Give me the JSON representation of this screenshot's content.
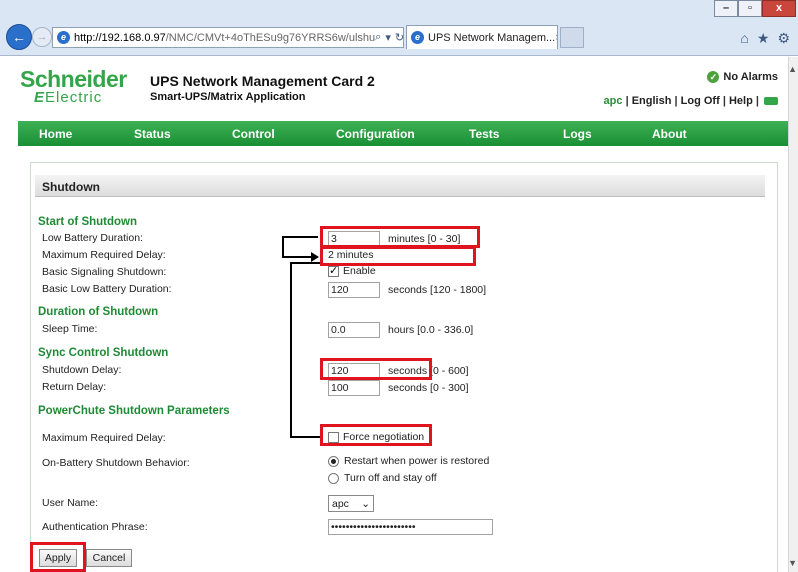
{
  "browser": {
    "url_host": "http://192.168.0.97",
    "url_path": "/NMC/CMVt+4oThESu9g76YRRS6w/ulshu",
    "tab_title": "UPS Network Managem...",
    "minimize": "–",
    "maximize": "▫",
    "close": "x"
  },
  "header": {
    "logo_line1": "Schneider",
    "logo_line2": "Electric",
    "product": "UPS Network Management Card 2",
    "subproduct": "Smart-UPS/Matrix Application",
    "alarms": "No Alarms",
    "user": "apc",
    "english": "English",
    "logoff": "Log Off",
    "help": "Help"
  },
  "nav": {
    "items": [
      "Home",
      "Status",
      "Control",
      "Configuration",
      "Tests",
      "Logs",
      "About"
    ]
  },
  "section": {
    "title": "Shutdown"
  },
  "start": {
    "heading": "Start of Shutdown",
    "low_battery_label": "Low Battery Duration:",
    "low_battery_value": "3",
    "low_battery_unit": "minutes  [0 - 30]",
    "max_delay_label": "Maximum Required Delay:",
    "max_delay_value": "2 minutes",
    "basic_signal_label": "Basic Signaling Shutdown:",
    "basic_signal_option": "Enable",
    "basic_low_label": "Basic Low Battery Duration:",
    "basic_low_value": "120",
    "basic_low_unit": "seconds  [120 - 1800]"
  },
  "duration": {
    "heading": "Duration of Shutdown",
    "sleep_label": "Sleep Time:",
    "sleep_value": "0.0",
    "sleep_unit": "hours [0.0 - 336.0]"
  },
  "sync": {
    "heading": "Sync Control Shutdown",
    "shutdown_delay_label": "Shutdown Delay:",
    "shutdown_delay_value": "120",
    "shutdown_delay_unit": "seconds  [0 - 600]",
    "return_delay_label": "Return Delay:",
    "return_delay_value": "100",
    "return_delay_unit": "seconds  [0 - 300]"
  },
  "powerchute": {
    "heading": "PowerChute Shutdown Parameters",
    "max_delay_label": "Maximum Required Delay:",
    "force_option": "Force negotiation",
    "onbattery_label": "On-Battery Shutdown Behavior:",
    "option_restart": "Restart when power is restored",
    "option_off": "Turn off and stay off",
    "username_label": "User Name:",
    "username_value": "apc",
    "auth_label": "Authentication Phrase:",
    "auth_value": "•••••••••••••••••••••••"
  },
  "buttons": {
    "apply": "Apply",
    "cancel": "Cancel"
  },
  "colors": {
    "brand_green": "#1e9a3c",
    "highlight_red": "#e0141f"
  }
}
